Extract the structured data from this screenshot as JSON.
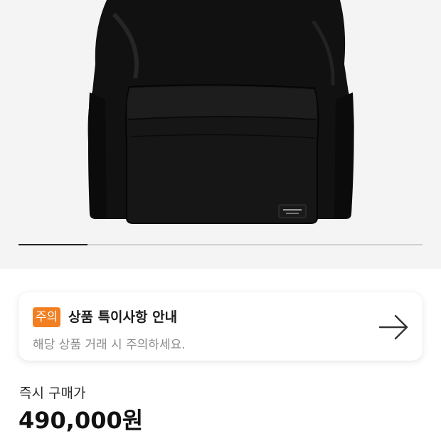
{
  "product_image": {
    "description": "black-backpack",
    "gallery_progress": 0.17
  },
  "notice": {
    "badge": "주의",
    "title": "상품 특이사항 안내",
    "description": "해당 상품 거래 시 주의하세요.",
    "arrow_icon": "arrow-right-icon",
    "badge_color": "#f27f21"
  },
  "price": {
    "label": "즉시 구매가",
    "value": "490,000원"
  }
}
